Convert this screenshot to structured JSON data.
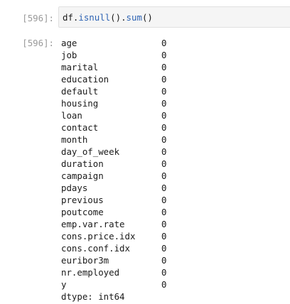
{
  "input_cell": {
    "prompt": "[596]:",
    "code": {
      "obj": "df",
      "dot1": ".",
      "fn1": "isnull",
      "call1": "()",
      "dot2": ".",
      "fn2": "sum",
      "call2": "()"
    }
  },
  "output_cell": {
    "prompt": "[596]:",
    "rows": [
      {
        "name": "age",
        "value": "0"
      },
      {
        "name": "job",
        "value": "0"
      },
      {
        "name": "marital",
        "value": "0"
      },
      {
        "name": "education",
        "value": "0"
      },
      {
        "name": "default",
        "value": "0"
      },
      {
        "name": "housing",
        "value": "0"
      },
      {
        "name": "loan",
        "value": "0"
      },
      {
        "name": "contact",
        "value": "0"
      },
      {
        "name": "month",
        "value": "0"
      },
      {
        "name": "day_of_week",
        "value": "0"
      },
      {
        "name": "duration",
        "value": "0"
      },
      {
        "name": "campaign",
        "value": "0"
      },
      {
        "name": "pdays",
        "value": "0"
      },
      {
        "name": "previous",
        "value": "0"
      },
      {
        "name": "poutcome",
        "value": "0"
      },
      {
        "name": "emp.var.rate",
        "value": "0"
      },
      {
        "name": "cons.price.idx",
        "value": "0"
      },
      {
        "name": "cons.conf.idx",
        "value": "0"
      },
      {
        "name": "euribor3m",
        "value": "0"
      },
      {
        "name": "nr.employed",
        "value": "0"
      },
      {
        "name": "y",
        "value": "0"
      }
    ],
    "dtype": "dtype: int64"
  },
  "colors": {
    "prompt": "#9a9a9a",
    "function": "#2f64b4",
    "input_bg": "#f5f5f5"
  }
}
